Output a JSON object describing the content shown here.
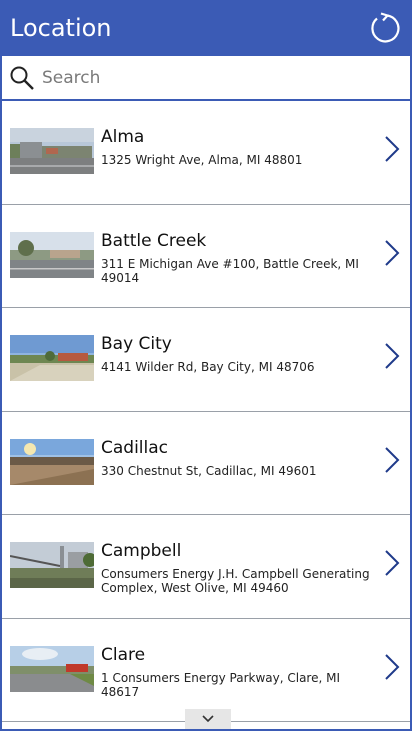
{
  "header": {
    "title": "Location",
    "refresh_icon": "refresh-icon"
  },
  "search": {
    "placeholder": "Search",
    "value": "",
    "icon": "search-icon"
  },
  "locations": [
    {
      "name": "Alma",
      "address": "1325 Wright Ave, Alma, MI 48801"
    },
    {
      "name": "Battle Creek",
      "address": "311 E Michigan Ave #100, Battle Creek, MI 49014"
    },
    {
      "name": "Bay City",
      "address": "4141 Wilder Rd, Bay City, MI 48706"
    },
    {
      "name": "Cadillac",
      "address": "330 Chestnut St, Cadillac, MI 49601"
    },
    {
      "name": "Campbell",
      "address": "Consumers Energy J.H. Campbell Generating Complex, West Olive, MI 49460"
    },
    {
      "name": "Clare",
      "address": "1 Consumers Energy Parkway, Clare, MI 48617"
    }
  ],
  "colors": {
    "accent": "#3b5bb5",
    "divider": "#9aa0a8"
  },
  "scroll_icon": "chevron-down-icon"
}
